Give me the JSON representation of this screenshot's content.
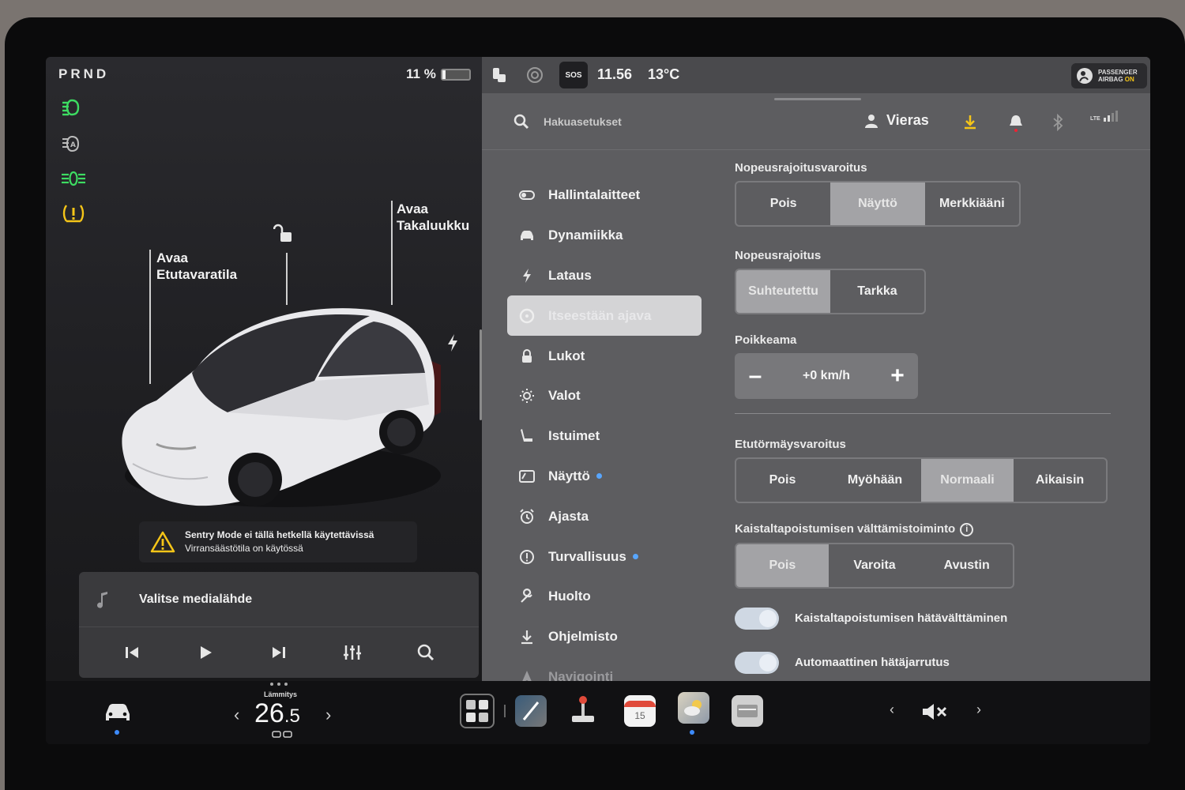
{
  "gear": "PRND",
  "battery": {
    "percent_text": "11 %",
    "level": 0.11
  },
  "callouts": {
    "frunk": [
      "Avaa",
      "Etutavaratila"
    ],
    "trunk": [
      "Avaa",
      "Takaluukku"
    ]
  },
  "sentry": {
    "line1": "Sentry Mode ei tällä hetkellä käytettävissä",
    "line2": "Virransäästötila on käytössä"
  },
  "media": {
    "source_label": "Valitse medialähde"
  },
  "status": {
    "time": "11.56",
    "outside_temp": "13°C",
    "sos": "SOS",
    "airbag_line1": "PASSENGER",
    "airbag_line2": "AIRBAG",
    "airbag_state": "ON"
  },
  "header": {
    "search_placeholder": "Hakuasetukset",
    "user_name": "Vieras",
    "signal": "LTE"
  },
  "menu": [
    {
      "label": "Hallintalaitteet",
      "icon": "toggle-icon"
    },
    {
      "label": "Dynamiikka",
      "icon": "car-icon"
    },
    {
      "label": "Lataus",
      "icon": "bolt-icon"
    },
    {
      "label": "Itseestään ajava",
      "icon": "steering-wheel-icon",
      "active": true
    },
    {
      "label": "Lukot",
      "icon": "lock-icon"
    },
    {
      "label": "Valot",
      "icon": "sun-icon"
    },
    {
      "label": "Istuimet",
      "icon": "seat-icon"
    },
    {
      "label": "Näyttö",
      "icon": "display-icon",
      "dot": true
    },
    {
      "label": "Ajasta",
      "icon": "alarm-clock-icon"
    },
    {
      "label": "Turvallisuus",
      "icon": "alert-circle-icon",
      "dot": true
    },
    {
      "label": "Huolto",
      "icon": "wrench-icon"
    },
    {
      "label": "Ohjelmisto",
      "icon": "download-icon"
    },
    {
      "label": "Navigointi",
      "icon": "navigation-icon"
    }
  ],
  "settings": {
    "speed_warning": {
      "title": "Nopeusrajoitusvaroitus",
      "options": [
        "Pois",
        "Näyttö",
        "Merkkiääni"
      ],
      "selected": 1
    },
    "speed_limit": {
      "title": "Nopeusrajoitus",
      "options": [
        "Suhteutettu",
        "Tarkka"
      ],
      "selected": 0
    },
    "offset": {
      "title": "Poikkeama",
      "value": "+0 km/h",
      "minus": "–",
      "plus": "+"
    },
    "fcw": {
      "title": "Etutörmäysvaroitus",
      "options": [
        "Pois",
        "Myöhään",
        "Normaali",
        "Aikaisin"
      ],
      "selected": 2
    },
    "lane_departure": {
      "title": "Kaistaltapoistumisen välttämistoiminto",
      "options": [
        "Pois",
        "Varoita",
        "Avustin"
      ],
      "selected": 0
    },
    "toggles": [
      {
        "label": "Kaistaltapoistumisen hätävälttäminen",
        "on": true
      },
      {
        "label": "Automaattinen hätäjarrutus",
        "on": true
      }
    ]
  },
  "dock": {
    "temp_label": "Lämmitys",
    "temp_int": "26",
    "temp_dec": ".5",
    "calendar_day": "15"
  }
}
